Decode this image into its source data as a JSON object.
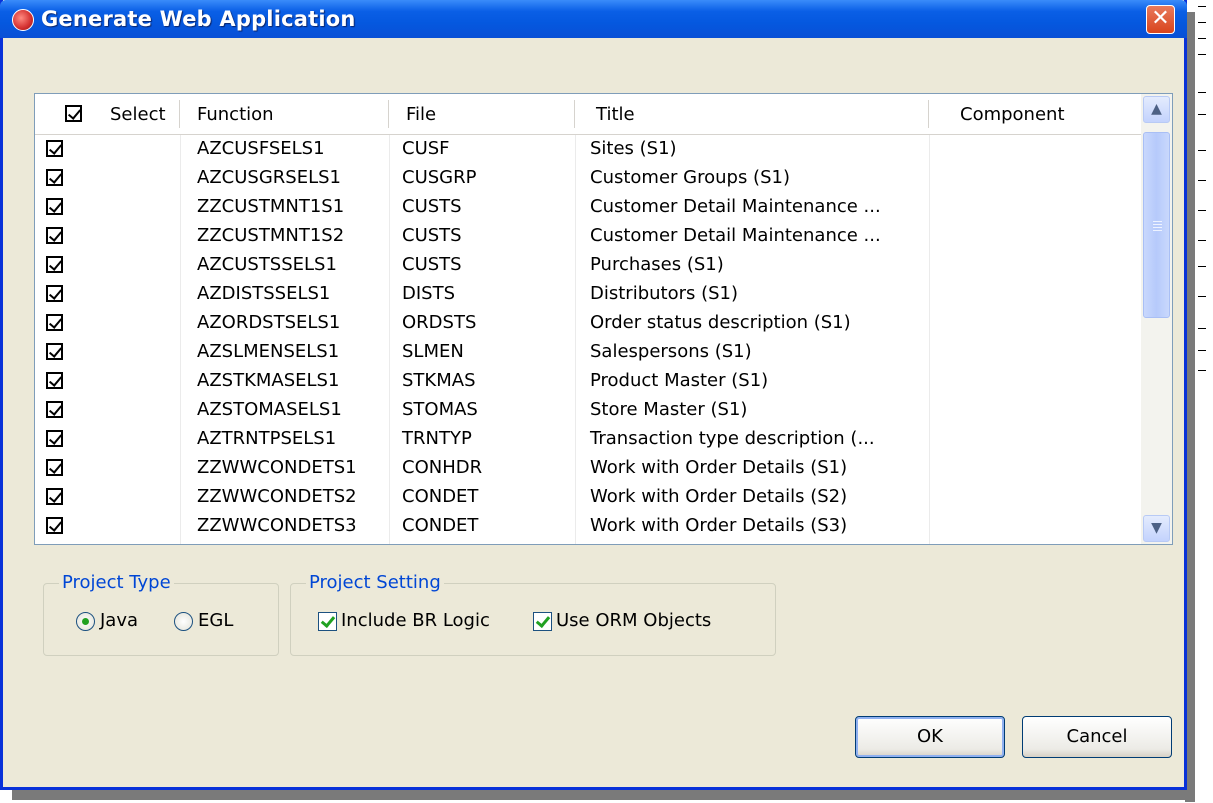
{
  "window": {
    "title": "Generate Web Application",
    "close_label": "✕"
  },
  "table": {
    "headers": {
      "select": "Select",
      "function": "Function",
      "file": "File",
      "title": "Title",
      "component": "Component"
    },
    "rows": [
      {
        "checked": true,
        "function": "AZCUSFSELS1",
        "file": "CUSF",
        "title": "Sites (S1)",
        "component": ""
      },
      {
        "checked": true,
        "function": "AZCUSGRSELS1",
        "file": "CUSGRP",
        "title": "Customer Groups (S1)",
        "component": ""
      },
      {
        "checked": true,
        "function": "ZZCUSTMNT1S1",
        "file": "CUSTS",
        "title": "Customer Detail Maintenance ...",
        "component": ""
      },
      {
        "checked": true,
        "function": "ZZCUSTMNT1S2",
        "file": "CUSTS",
        "title": "Customer Detail Maintenance ...",
        "component": ""
      },
      {
        "checked": true,
        "function": "AZCUSTSSELS1",
        "file": "CUSTS",
        "title": "Purchases (S1)",
        "component": ""
      },
      {
        "checked": true,
        "function": "AZDISTSSELS1",
        "file": "DISTS",
        "title": "Distributors (S1)",
        "component": ""
      },
      {
        "checked": true,
        "function": "AZORDSTSELS1",
        "file": "ORDSTS",
        "title": "Order status description (S1)",
        "component": ""
      },
      {
        "checked": true,
        "function": "AZSLMENSELS1",
        "file": "SLMEN",
        "title": "Salespersons (S1)",
        "component": ""
      },
      {
        "checked": true,
        "function": "AZSTKMASELS1",
        "file": "STKMAS",
        "title": "Product Master (S1)",
        "component": ""
      },
      {
        "checked": true,
        "function": "AZSTOMASELS1",
        "file": "STOMAS",
        "title": "Store Master (S1)",
        "component": ""
      },
      {
        "checked": true,
        "function": "AZTRNTPSELS1",
        "file": "TRNTYP",
        "title": "Transaction type description (...",
        "component": ""
      },
      {
        "checked": true,
        "function": "ZZWWCONDETS1",
        "file": "CONHDR",
        "title": "Work with Order Details (S1)",
        "component": ""
      },
      {
        "checked": true,
        "function": "ZZWWCONDETS2",
        "file": "CONDET",
        "title": "Work with Order Details (S2)",
        "component": ""
      },
      {
        "checked": true,
        "function": "ZZWWCONDETS3",
        "file": "CONDET",
        "title": "Work with Order Details (S3)",
        "component": ""
      }
    ]
  },
  "project_type": {
    "label": "Project Type",
    "options": [
      "Java",
      "EGL"
    ],
    "selected": "Java"
  },
  "project_setting": {
    "label": "Project Setting",
    "include_br_logic": {
      "label": "Include BR Logic",
      "checked": true
    },
    "use_orm_objects": {
      "label": "Use ORM Objects",
      "checked": true
    }
  },
  "buttons": {
    "ok": "OK",
    "cancel": "Cancel"
  },
  "icons": {
    "title": "app-icon",
    "scroll_up": "chevron-up-icon",
    "scroll_down": "chevron-down-icon"
  },
  "colors": {
    "titlebar": "#0558df",
    "dialog_bg": "#ece9d8",
    "group_label": "#0046d5",
    "close": "#d9441c"
  }
}
